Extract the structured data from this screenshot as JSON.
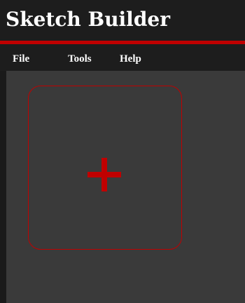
{
  "app": {
    "title": "Sketch Builder"
  },
  "menu": {
    "items": [
      {
        "label": "File"
      },
      {
        "label": "Tools"
      },
      {
        "label": "Help"
      }
    ]
  },
  "canvas": {
    "add_tile": {
      "icon": "plus-icon"
    }
  },
  "colors": {
    "accent": "#c00000",
    "titlebar_bg": "#1d1d1d",
    "canvas_bg": "#3a3a3a",
    "text": "#ffffff"
  }
}
